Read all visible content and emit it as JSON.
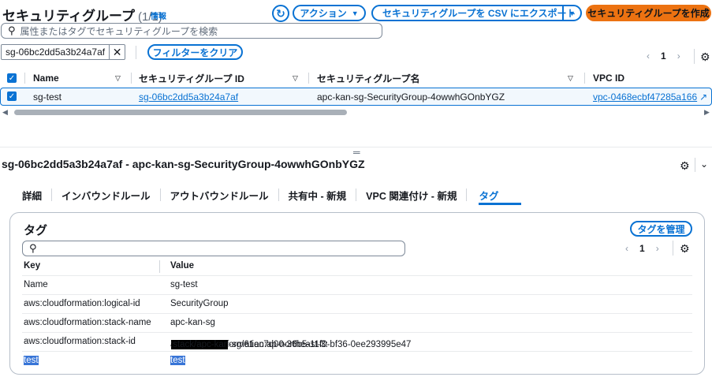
{
  "header": {
    "title": "セキュリティグループ",
    "count": "(1/1)",
    "info": "情報",
    "refresh_icon": "refresh-icon",
    "actions_label": "アクション",
    "export_label": "セキュリティグループを CSV にエクスポート",
    "create_label": "セキュリティグループを作成"
  },
  "search": {
    "placeholder": "属性またはタグでセキュリティグループを検索"
  },
  "filter": {
    "token": "sg-06bc2dd5a3b24a7af",
    "clear_label": "フィルターをクリア"
  },
  "pagination": {
    "page": "1",
    "prev": "‹",
    "next": "›"
  },
  "table": {
    "columns": [
      "Name",
      "セキュリティグループ ID",
      "セキュリティグループ名",
      "VPC ID"
    ],
    "rows": [
      {
        "name": "sg-test",
        "id": "sg-06bc2dd5a3b24a7af",
        "group_name": "apc-kan-sg-SecurityGroup-4owwhGOnbYGZ",
        "vpc": "vpc-0468ecbf47285a166"
      }
    ]
  },
  "detail": {
    "title": "sg-06bc2dd5a3b24a7af - apc-kan-sg-SecurityGroup-4owwhGOnbYGZ",
    "tabs": [
      "詳細",
      "インバウンドルール",
      "アウトバウンドルール",
      "共有中 - 新規",
      "VPC 関連付け - 新規",
      "タグ"
    ],
    "active_tab": "タグ"
  },
  "tags": {
    "title": "タグ",
    "manage_label": "タグを管理",
    "page": "1",
    "columns": [
      "Key",
      "Value"
    ],
    "rows": [
      {
        "key": "Name",
        "value": "sg-test"
      },
      {
        "key": "aws:cloudformation:logical-id",
        "value": "SecurityGroup"
      },
      {
        "key": "aws:cloudformation:stack-name",
        "value": "apc-kan-sg"
      },
      {
        "key": "aws:cloudformation:stack-id",
        "value_prefix": "arn:aws:cloudformation:ap-northeast-3:",
        "value_suffix": ":stack/apc-kan-sg/61ac7d00-36b5-11f0-bf36-0ee293995e47"
      },
      {
        "key": "test",
        "value": "test"
      }
    ]
  },
  "colors": {
    "accent": "#0972d3",
    "primary": "#ec7211"
  }
}
